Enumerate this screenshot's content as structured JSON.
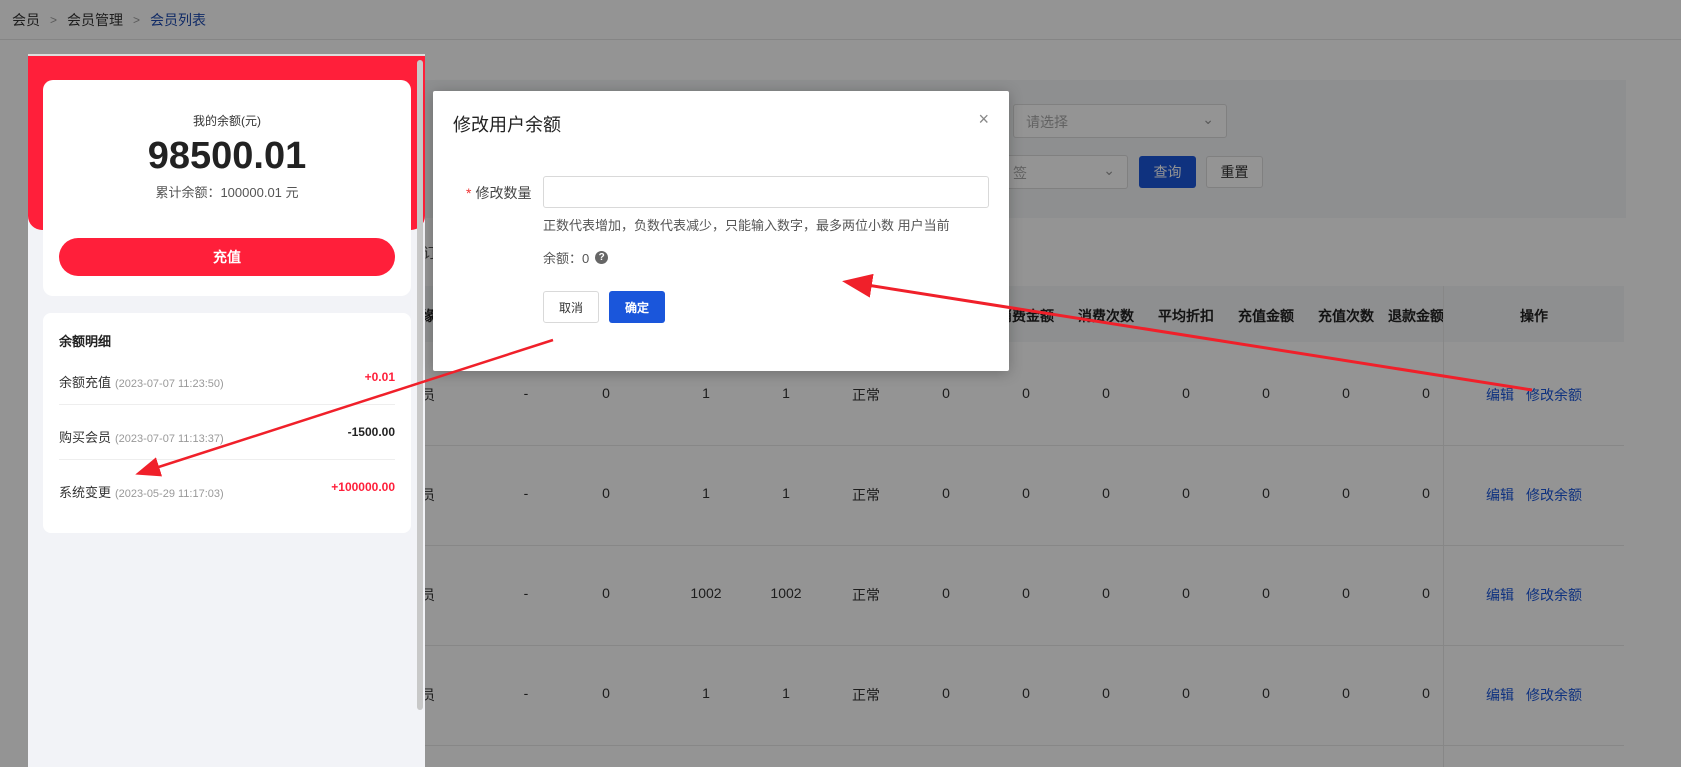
{
  "breadcrumb": [
    "会员",
    "会员管理",
    "会员列表"
  ],
  "filters": {
    "select_placeholder": "请选择",
    "select2_text": "签",
    "query_label": "查询",
    "reset_label": "重置"
  },
  "table": {
    "headers": [
      "消费金额",
      "消费次数",
      "平均折扣",
      "充值金额",
      "充值次数",
      "退款金额",
      "操作"
    ],
    "rows": [
      {
        "c0": "员",
        "c1": "-",
        "c2": "0",
        "c3": "1",
        "c4": "1",
        "c5": "正常",
        "c6": "0",
        "c7": "0",
        "c8": "0",
        "c9": "0",
        "c10": "0",
        "c11": "0",
        "c12": "0"
      },
      {
        "c0": "员",
        "c1": "-",
        "c2": "0",
        "c3": "1",
        "c4": "1",
        "c5": "正常",
        "c6": "0",
        "c7": "0",
        "c8": "0",
        "c9": "0",
        "c10": "0",
        "c11": "0",
        "c12": "0"
      },
      {
        "c0": "员",
        "c1": "-",
        "c2": "0",
        "c3": "1002",
        "c4": "1002",
        "c5": "正常",
        "c6": "0",
        "c7": "0",
        "c8": "0",
        "c9": "0",
        "c10": "0",
        "c11": "0",
        "c12": "0"
      },
      {
        "c0": "员",
        "c1": "-",
        "c2": "0",
        "c3": "1",
        "c4": "1",
        "c5": "正常",
        "c6": "0",
        "c7": "0",
        "c8": "0",
        "c9": "0",
        "c10": "0",
        "c11": "0",
        "c12": "0"
      }
    ],
    "edit_label": "编辑",
    "modify_balance_label": "修改余额",
    "partial_left_header": "缘",
    "partial_left_label": "订"
  },
  "phone": {
    "balance_label": "我的余额(元)",
    "balance_value": "98500.01",
    "total_label": "累计余额：100000.01 元",
    "recharge_label": "充值",
    "detail_title": "余额明细",
    "items": [
      {
        "name": "余额充值",
        "time": "(2023-07-07 11:23:50)",
        "amount": "+0.01",
        "type": "pos"
      },
      {
        "name": "购买会员",
        "time": "(2023-07-07 11:13:37)",
        "amount": "-1500.00",
        "type": "neg"
      },
      {
        "name": "系统变更",
        "time": "(2023-05-29 11:17:03)",
        "amount": "+100000.00",
        "type": "pos"
      }
    ]
  },
  "modal": {
    "title": "修改用户余额",
    "close": "×",
    "field_label": "修改数量",
    "required_mark": "*",
    "input_value": "",
    "hint": "正数代表增加，负数代表减少，只能输入数字，最多两位小数 用户当前",
    "balance_text": "余额：0",
    "help_icon": "?",
    "cancel_label": "取消",
    "ok_label": "确定"
  },
  "colors": {
    "primary": "#1a56db",
    "phone_red": "#ff1f3a",
    "arrow_red": "#f0202a"
  }
}
